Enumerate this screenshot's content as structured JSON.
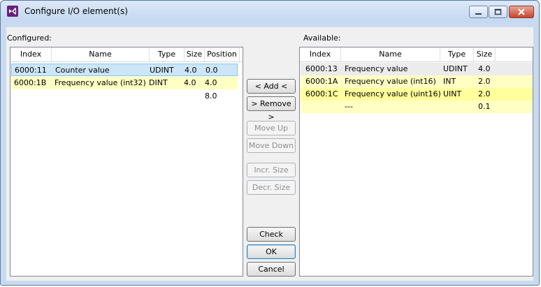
{
  "window": {
    "title": "Configure I/O element(s)",
    "accent": "#c9daf0"
  },
  "labels": {
    "configured": "Configured:",
    "available": "Available:"
  },
  "configured": {
    "columns": [
      "Index",
      "Name",
      "Type",
      "Size",
      "Position"
    ],
    "rows": [
      {
        "index": "6000:11",
        "name": "Counter value",
        "type": "UDINT",
        "size": "4.0",
        "position": "0.0",
        "state": "selected"
      },
      {
        "index": "6000:1B",
        "name": "Frequency value (int32)",
        "type": "DINT",
        "size": "4.0",
        "position": "4.0",
        "state": "highlight"
      },
      {
        "index": "",
        "name": "",
        "type": "",
        "size": "",
        "position": "8.0",
        "state": "none"
      }
    ]
  },
  "available": {
    "columns": [
      "Index",
      "Name",
      "Type",
      "Size"
    ],
    "rows": [
      {
        "index": "6000:13",
        "name": "Frequency value",
        "type": "UDINT",
        "size": "4.0",
        "state": "gray"
      },
      {
        "index": "6000:1A",
        "name": "Frequency value (int16)",
        "type": "INT",
        "size": "2.0",
        "state": "highlight"
      },
      {
        "index": "6000:1C",
        "name": "Frequency value (uint16)",
        "type": "UINT",
        "size": "2.0",
        "state": "highlight-strong"
      },
      {
        "index": "",
        "name": "---",
        "type": "",
        "size": "0.1",
        "state": "highlight"
      }
    ]
  },
  "buttons": {
    "add": "< Add <",
    "remove": "> Remove >",
    "move_up": "Move Up",
    "move_down": "Move Down",
    "incr_size": "Incr. Size",
    "decr_size": "Decr. Size",
    "check": "Check",
    "ok": "OK",
    "cancel": "Cancel"
  },
  "colors": {
    "selected": "#cde6f7",
    "highlight": "#ffffc4",
    "highlight_strong": "#ffff9c",
    "gray": "#ececec"
  }
}
